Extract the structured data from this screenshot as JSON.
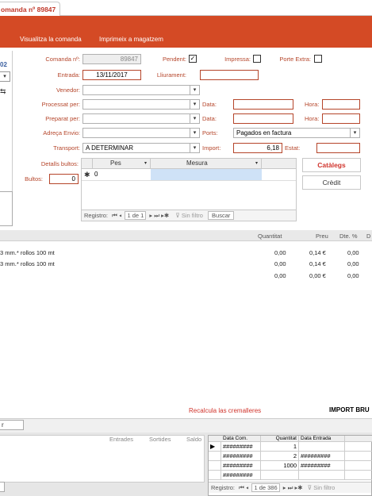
{
  "tab": {
    "title": "omanda nº 89847"
  },
  "header": {
    "link_view": "Visualitza la comanda",
    "link_print": "Imprimeix a magatzem"
  },
  "left_fragment": {
    "text_02": "02"
  },
  "form": {
    "comanda_label": "Comanda nº:",
    "comanda_value": "89847",
    "pendent_label": "Pendent:",
    "pendent_checked": "✓",
    "impressa_label": "Impressa:",
    "porte_label": "Porte Extra:",
    "entrada_label": "Entrada:",
    "entrada_value": "13/11/2017",
    "lliurament_label": "Lliurament:",
    "lliurament_value": "",
    "venedor_label": "Venedor:",
    "processat_label": "Processat per:",
    "preparat_label": "Preparat per:",
    "adreca_label": "Adreça Envio:",
    "transport_label": "Transport:",
    "transport_value": "A DETERMINAR",
    "data_label": "Data:",
    "hora_label": "Hora:",
    "ports_label": "Ports:",
    "ports_value": "Pagados en factura",
    "import_label": "Import:",
    "import_value": "6,18",
    "estat_label": "Estat:",
    "detalls_label": "Detalls bultos:",
    "bultos_label": "Bultos:",
    "bultos_value": "0"
  },
  "subgrid": {
    "col_pes": "Pes",
    "col_mesura": "Mesura",
    "row_marker": "✱",
    "row_value": "0",
    "nav_registro": "Registro:",
    "nav_pos": "1 de 1",
    "nav_filter": "Sin filtro",
    "nav_search": "Buscar"
  },
  "buttons": {
    "catalegs": "Catàlegs",
    "credit": "Crèdit"
  },
  "lines": {
    "headers": {
      "quantitat": "Quantitat",
      "preu": "Preu",
      "dte": "Dte. %",
      "d": "D"
    },
    "rows": [
      {
        "desc": "3 mm.* rollos 100 mt",
        "qty": "0,00",
        "price": "0,14 €",
        "dte": "0,00"
      },
      {
        "desc": "3 mm.* rollos 100 mt",
        "qty": "0,00",
        "price": "0,14 €",
        "dte": "0,00"
      },
      {
        "desc": "",
        "qty": "0,00",
        "price": "0,00 €",
        "dte": "0,00"
      }
    ],
    "recalc": "Recalcula las cremalleres",
    "import_brut": "IMPORT BRU"
  },
  "bottom": {
    "strip_text": "r",
    "hdr_entrades": "Entrades",
    "hdr_sortides": "Sortides",
    "hdr_saldo": "Saldo",
    "grid_headers": {
      "data_com": "Data Com.",
      "quantitat": "Quantitat",
      "data_entrada": "Data Entrada"
    },
    "rows": [
      {
        "marker": "▶",
        "data_com": "#########",
        "qty": "1",
        "data_entrada": ""
      },
      {
        "marker": "",
        "data_com": "#########",
        "qty": "2",
        "data_entrada": "#########"
      },
      {
        "marker": "",
        "data_com": "#########",
        "qty": "1000",
        "data_entrada": "#########"
      },
      {
        "marker": "",
        "data_com": "#########",
        "qty": "",
        "data_entrada": ""
      }
    ],
    "nav_registro": "Registro:",
    "nav_pos": "1 de 386",
    "nav_filter": "Sin filtro"
  }
}
